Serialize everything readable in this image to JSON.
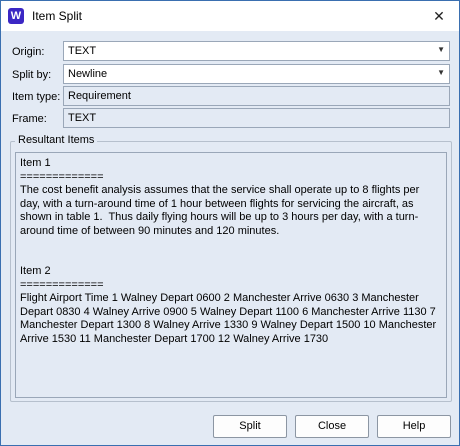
{
  "window": {
    "title": "Item Split",
    "app_icon_letter": "W",
    "close_glyph": "✕"
  },
  "form": {
    "origin_label": "Origin:",
    "origin_value": "TEXT",
    "split_by_label": "Split by:",
    "split_by_value": "Newline",
    "item_type_label": "Item type:",
    "item_type_value": "Requirement",
    "frame_label": "Frame:",
    "frame_value": "TEXT"
  },
  "results": {
    "group_label": "Resultant Items",
    "items": [
      {
        "title": "Item 1",
        "separator": "=============",
        "body": "The cost benefit analysis assumes that the service shall operate up to 8 flights per day, with a turn-around time of 1 hour between flights for servicing the aircraft, as shown in table 1.  Thus daily flying hours will be up to 3 hours per day, with a turn-around time of between 90 minutes and 120 minutes."
      },
      {
        "title": "Item 2",
        "separator": "=============",
        "body": "Flight Airport Time 1 Walney Depart 0600 2 Manchester Arrive 0630 3 Manchester Depart 0830 4 Walney Arrive 0900 5 Walney Depart 1100 6 Manchester Arrive 1130 7 Manchester Depart 1300 8 Walney Arrive 1330 9 Walney Depart 1500 10 Manchester Arrive 1530 11 Manchester Depart 1700 12 Walney Arrive 1730"
      }
    ]
  },
  "buttons": {
    "split": "Split",
    "close": "Close",
    "help": "Help"
  },
  "colors": {
    "accent": "#3b27c4",
    "dialog_bg": "#e3eaf4",
    "border": "#3a6fb0"
  }
}
